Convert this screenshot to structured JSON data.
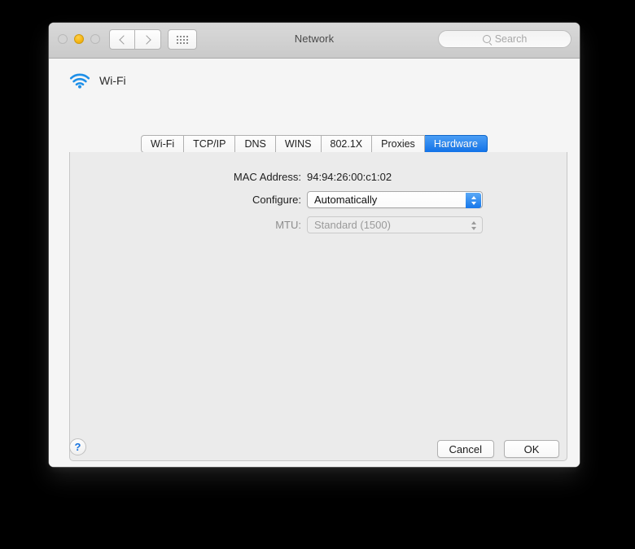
{
  "window": {
    "title": "Network",
    "traffic_lights": [
      {
        "name": "close",
        "state": "inactive"
      },
      {
        "name": "minimize",
        "state": "amber"
      },
      {
        "name": "zoom",
        "state": "inactive"
      }
    ],
    "nav": {
      "back_icon": "chevron-left-icon",
      "forward_icon": "chevron-right-icon",
      "show_all_icon": "grid-icon"
    },
    "search": {
      "icon": "search-icon",
      "placeholder": "Search",
      "value": ""
    }
  },
  "service": {
    "icon": "wifi-icon",
    "name": "Wi-Fi"
  },
  "tabs": [
    {
      "label": "Wi-Fi",
      "selected": false
    },
    {
      "label": "TCP/IP",
      "selected": false
    },
    {
      "label": "DNS",
      "selected": false
    },
    {
      "label": "WINS",
      "selected": false
    },
    {
      "label": "802.1X",
      "selected": false
    },
    {
      "label": "Proxies",
      "selected": false
    },
    {
      "label": "Hardware",
      "selected": true
    }
  ],
  "hardware_pane": {
    "mac_address": {
      "label": "MAC Address:",
      "value": "94:94:26:00:c1:02"
    },
    "configure": {
      "label": "Configure:",
      "value": "Automatically",
      "enabled": true
    },
    "mtu": {
      "label": "MTU:",
      "value": "Standard  (1500)",
      "enabled": false
    }
  },
  "footer": {
    "help_label": "?",
    "cancel_label": "Cancel",
    "ok_label": "OK"
  },
  "colors": {
    "accent_blue": "#1677ea",
    "selected_tab_blue": "#1273e8",
    "wifi_icon_blue": "#1e8fe8",
    "amber": "#f5b513",
    "panel_bg": "#ebebeb",
    "window_bg": "#f5f5f5",
    "toolbar_top": "#d9d9d9",
    "desktop_bg": "#000000"
  }
}
